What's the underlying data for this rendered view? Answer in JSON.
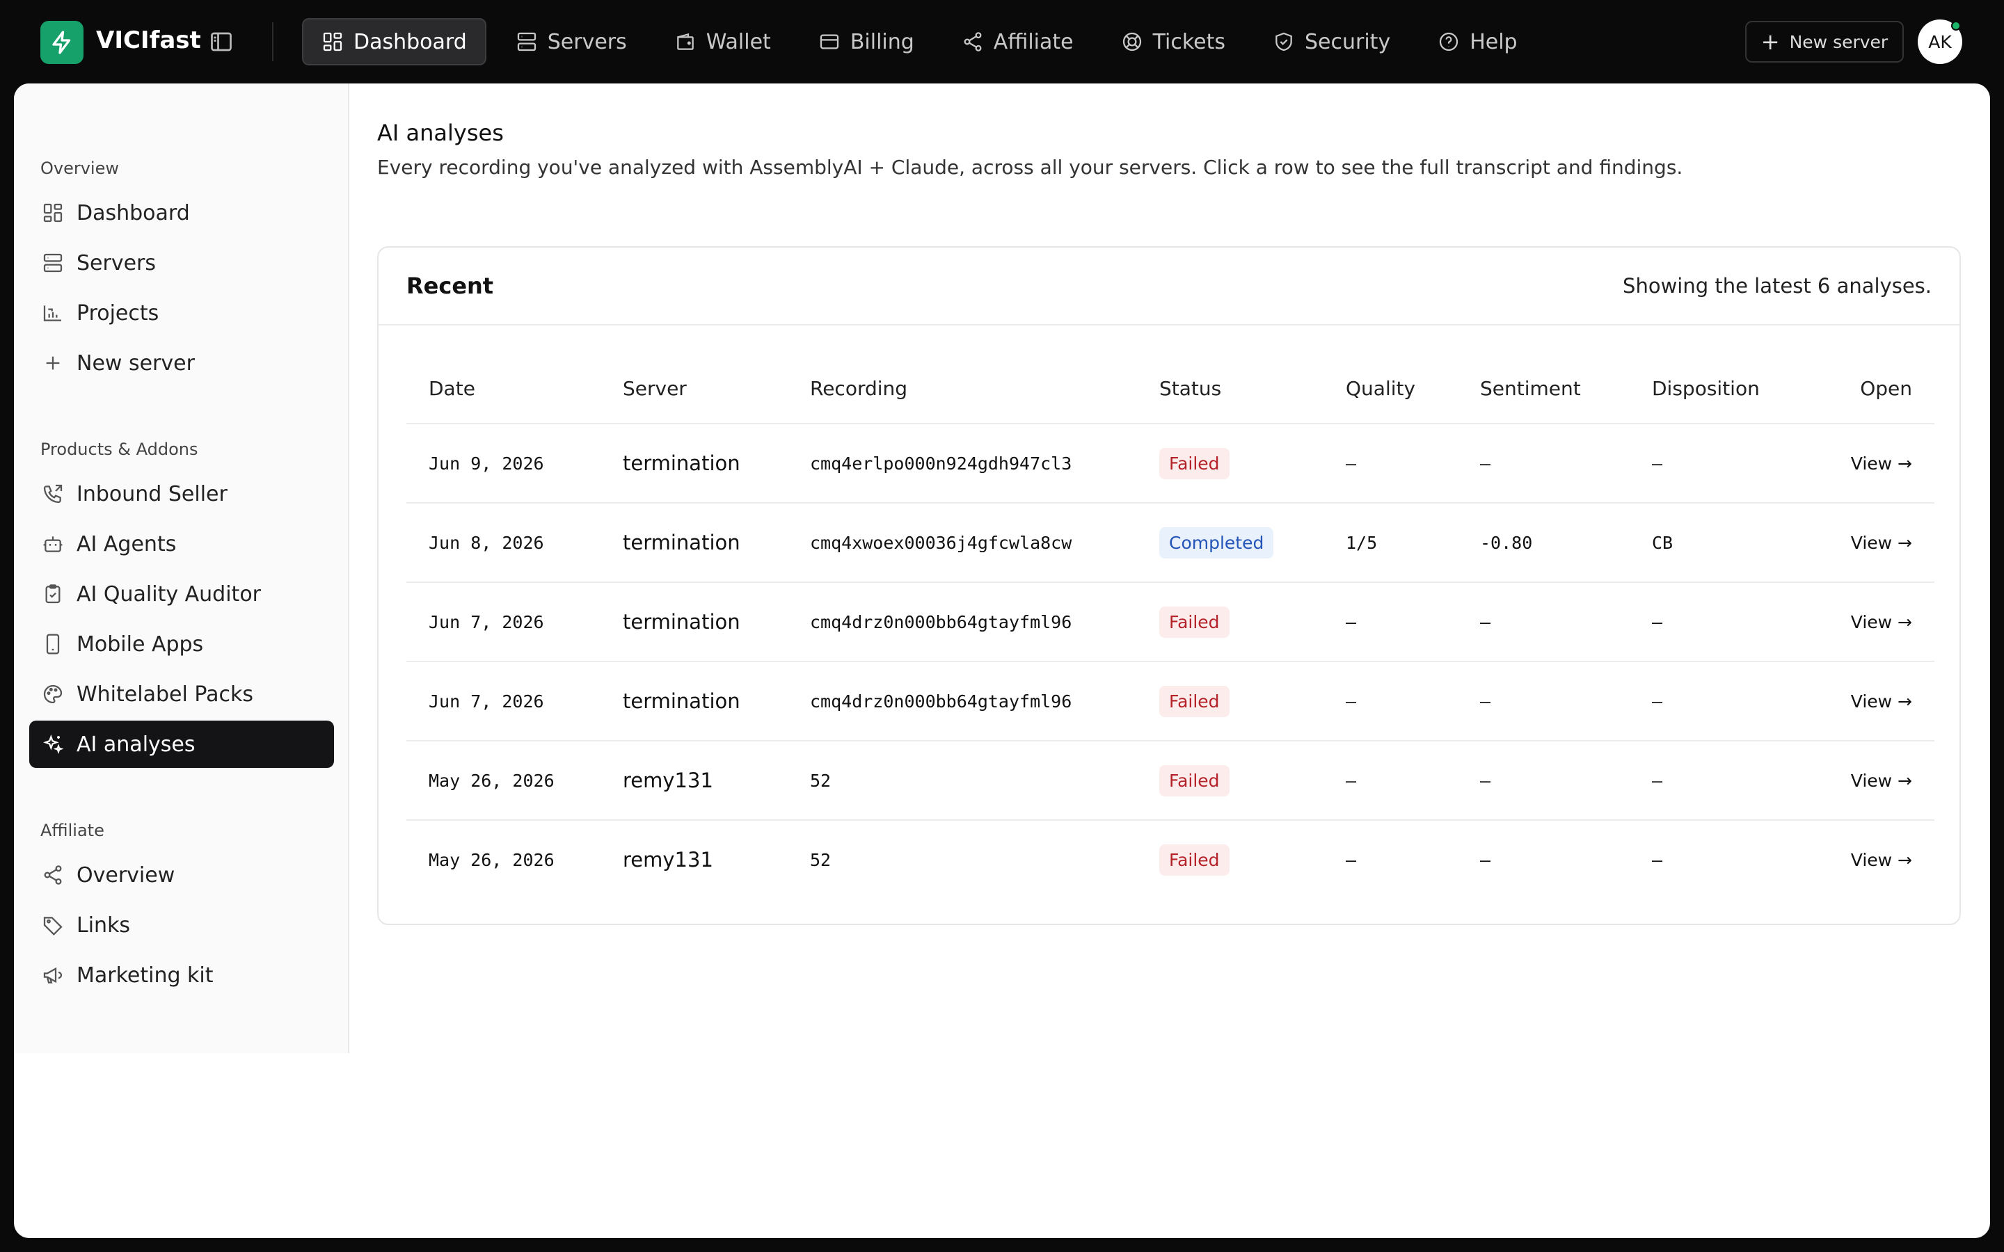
{
  "app": {
    "name": "VICIfast"
  },
  "nav": {
    "items": [
      {
        "label": "Dashboard",
        "icon": "dashboard-icon",
        "active": true
      },
      {
        "label": "Servers",
        "icon": "servers-icon"
      },
      {
        "label": "Wallet",
        "icon": "wallet-icon"
      },
      {
        "label": "Billing",
        "icon": "credit-card-icon"
      },
      {
        "label": "Affiliate",
        "icon": "share-icon"
      },
      {
        "label": "Tickets",
        "icon": "lifebuoy-icon"
      },
      {
        "label": "Security",
        "icon": "shield-icon"
      },
      {
        "label": "Help",
        "icon": "help-icon"
      }
    ],
    "new_server": "New server",
    "avatar_initials": "AK"
  },
  "sidebar": {
    "sections": [
      {
        "heading": "Overview",
        "items": [
          {
            "label": "Dashboard",
            "icon": "dashboard-icon"
          },
          {
            "label": "Servers",
            "icon": "servers-icon"
          },
          {
            "label": "Projects",
            "icon": "chart-icon"
          },
          {
            "label": "New server",
            "icon": "plus-icon"
          }
        ]
      },
      {
        "heading": "Products & Addons",
        "items": [
          {
            "label": "Inbound Seller",
            "icon": "phone-icon"
          },
          {
            "label": "AI Agents",
            "icon": "bot-icon"
          },
          {
            "label": "AI Quality Auditor",
            "icon": "clipboard-check-icon"
          },
          {
            "label": "Mobile Apps",
            "icon": "smartphone-icon"
          },
          {
            "label": "Whitelabel Packs",
            "icon": "palette-icon"
          },
          {
            "label": "AI analyses",
            "icon": "sparkles-icon",
            "active": true
          }
        ]
      },
      {
        "heading": "Affiliate",
        "items": [
          {
            "label": "Overview",
            "icon": "share-icon"
          },
          {
            "label": "Links",
            "icon": "tag-icon"
          },
          {
            "label": "Marketing kit",
            "icon": "megaphone-icon"
          }
        ]
      }
    ]
  },
  "page": {
    "title": "AI analyses",
    "subtitle": "Every recording you've analyzed with AssemblyAI + Claude, across all your servers. Click a row to see the full transcript and findings."
  },
  "card": {
    "title": "Recent",
    "note": "Showing the latest 6 analyses.",
    "columns": [
      "Date",
      "Server",
      "Recording",
      "Status",
      "Quality",
      "Sentiment",
      "Disposition",
      "Open"
    ],
    "rows": [
      {
        "date": "Jun 9, 2026",
        "server": "termination",
        "recording": "cmq4erlpo000n924gdh947cl3",
        "status": "Failed",
        "quality": "–",
        "sentiment": "–",
        "disposition": "—",
        "open": "View →"
      },
      {
        "date": "Jun 8, 2026",
        "server": "termination",
        "recording": "cmq4xwoex00036j4gfcwla8cw",
        "status": "Completed",
        "quality": "1/5",
        "sentiment": "-0.80",
        "disposition": "CB",
        "open": "View →"
      },
      {
        "date": "Jun 7, 2026",
        "server": "termination",
        "recording": "cmq4drz0n000bb64gtayfml96",
        "status": "Failed",
        "quality": "–",
        "sentiment": "–",
        "disposition": "—",
        "open": "View →"
      },
      {
        "date": "Jun 7, 2026",
        "server": "termination",
        "recording": "cmq4drz0n000bb64gtayfml96",
        "status": "Failed",
        "quality": "–",
        "sentiment": "–",
        "disposition": "—",
        "open": "View →"
      },
      {
        "date": "May 26, 2026",
        "server": "remy131",
        "recording": "52",
        "status": "Failed",
        "quality": "–",
        "sentiment": "–",
        "disposition": "—",
        "open": "View →"
      },
      {
        "date": "May 26, 2026",
        "server": "remy131",
        "recording": "52",
        "status": "Failed",
        "quality": "–",
        "sentiment": "–",
        "disposition": "—",
        "open": "View →"
      }
    ]
  },
  "colors": {
    "brand": "#17a16a",
    "topbar_bg": "#0a0a0a",
    "active_sidebar_bg": "#141416",
    "failed_text": "#b4232a",
    "failed_bg": "#fdecec",
    "completed_text": "#2354b8",
    "completed_bg": "#e9f1fd"
  }
}
